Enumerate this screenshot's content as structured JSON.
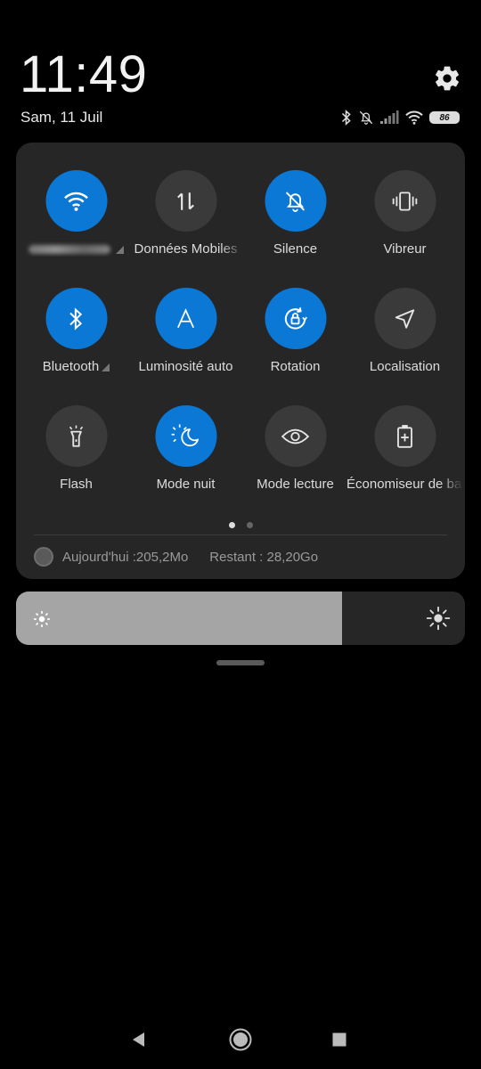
{
  "status": {
    "time": "11:49",
    "date": "Sam, 11 Juil",
    "battery": "86"
  },
  "tiles": [
    {
      "label": "",
      "icon": "wifi-icon",
      "on": true,
      "blurred_label": true
    },
    {
      "label": "Données Mobiles",
      "icon": "mobile-data-icon",
      "on": false
    },
    {
      "label": "Silence",
      "icon": "bell-off-icon",
      "on": true
    },
    {
      "label": "Vibreur",
      "icon": "vibrate-icon",
      "on": false
    },
    {
      "label": "Bluetooth",
      "icon": "bluetooth-icon",
      "on": true
    },
    {
      "label": "Luminosité auto",
      "icon": "auto-brightness-icon",
      "on": true
    },
    {
      "label": "Rotation",
      "icon": "rotation-lock-icon",
      "on": true
    },
    {
      "label": "Localisation",
      "icon": "location-icon",
      "on": false
    },
    {
      "label": "Flash",
      "icon": "flashlight-icon",
      "on": false
    },
    {
      "label": "Mode nuit",
      "icon": "night-mode-icon",
      "on": true
    },
    {
      "label": "Mode lecture",
      "icon": "eye-icon",
      "on": false
    },
    {
      "label": "Économiseur de batterie",
      "icon": "battery-saver-icon",
      "on": false
    }
  ],
  "data_usage": {
    "today": "Aujourd'hui :205,2Mo",
    "remaining": "Restant : 28,20Go"
  },
  "brightness": {
    "level": 0.726
  },
  "colors": {
    "accent": "#0a78d4",
    "tile_off": "#3a3a3b",
    "panel": "#262627"
  }
}
